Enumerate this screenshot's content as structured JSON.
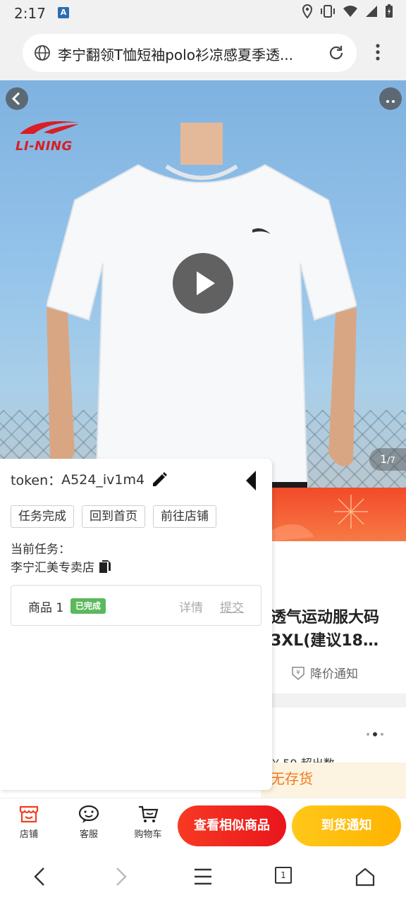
{
  "status_bar": {
    "time": "2:17",
    "notification_badge": "A"
  },
  "browser": {
    "url_text": "李宁翻领T恤短袖polo衫凉感夏季透...",
    "icons": [
      "globe-icon",
      "reload-icon",
      "overflow-menu-icon"
    ]
  },
  "product": {
    "brand_logo": "LI-NING",
    "image_counter_current": "1",
    "image_counter_total": "/7",
    "title_line1": "透气运动服大码",
    "title_line2": "3XL(建议18…",
    "price_notify": "降价通知",
    "partial_text": "¥ 59 超出数",
    "out_of_stock": "无存货"
  },
  "panel": {
    "token_label": "token：",
    "token_value": "A524_iv1m4",
    "buttons": [
      "任务完成",
      "回到首页",
      "前往店铺"
    ],
    "task_label": "当前任务：",
    "task_value": "李宁汇美专卖店",
    "goods": {
      "name": "商品 1",
      "badge": "已完成",
      "detail": "详情",
      "submit": "提交"
    }
  },
  "action_bar": {
    "store": "店铺",
    "service": "客服",
    "cart": "购物车",
    "similar_button": "查看相似商品",
    "notify_button": "到货通知"
  },
  "system_nav": {
    "tabs_count": "1"
  },
  "colors": {
    "brand_red": "#d91e25",
    "cta_red": "#f73a23",
    "cta_yellow": "#ffc81a",
    "done_green": "#5cb85c",
    "stock_orange": "#f27a1a"
  }
}
